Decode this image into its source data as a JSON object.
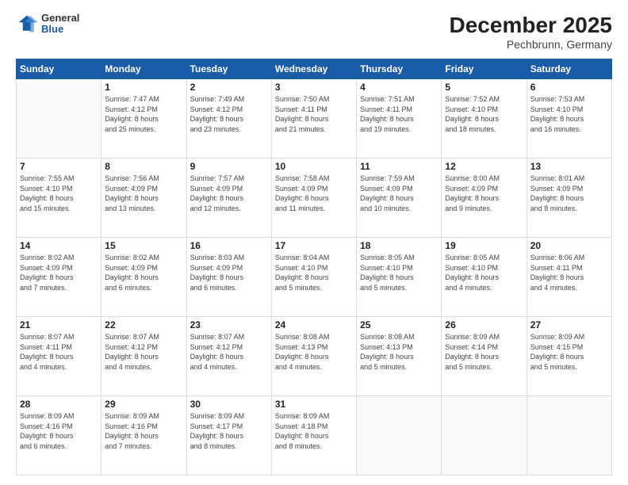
{
  "header": {
    "logo_general": "General",
    "logo_blue": "Blue",
    "title": "December 2025",
    "subtitle": "Pechbrunn, Germany"
  },
  "days_of_week": [
    "Sunday",
    "Monday",
    "Tuesday",
    "Wednesday",
    "Thursday",
    "Friday",
    "Saturday"
  ],
  "weeks": [
    [
      {
        "num": "",
        "info": ""
      },
      {
        "num": "1",
        "info": "Sunrise: 7:47 AM\nSunset: 4:12 PM\nDaylight: 8 hours\nand 25 minutes."
      },
      {
        "num": "2",
        "info": "Sunrise: 7:49 AM\nSunset: 4:12 PM\nDaylight: 8 hours\nand 23 minutes."
      },
      {
        "num": "3",
        "info": "Sunrise: 7:50 AM\nSunset: 4:11 PM\nDaylight: 8 hours\nand 21 minutes."
      },
      {
        "num": "4",
        "info": "Sunrise: 7:51 AM\nSunset: 4:11 PM\nDaylight: 8 hours\nand 19 minutes."
      },
      {
        "num": "5",
        "info": "Sunrise: 7:52 AM\nSunset: 4:10 PM\nDaylight: 8 hours\nand 18 minutes."
      },
      {
        "num": "6",
        "info": "Sunrise: 7:53 AM\nSunset: 4:10 PM\nDaylight: 8 hours\nand 16 minutes."
      }
    ],
    [
      {
        "num": "7",
        "info": "Sunrise: 7:55 AM\nSunset: 4:10 PM\nDaylight: 8 hours\nand 15 minutes."
      },
      {
        "num": "8",
        "info": "Sunrise: 7:56 AM\nSunset: 4:09 PM\nDaylight: 8 hours\nand 13 minutes."
      },
      {
        "num": "9",
        "info": "Sunrise: 7:57 AM\nSunset: 4:09 PM\nDaylight: 8 hours\nand 12 minutes."
      },
      {
        "num": "10",
        "info": "Sunrise: 7:58 AM\nSunset: 4:09 PM\nDaylight: 8 hours\nand 11 minutes."
      },
      {
        "num": "11",
        "info": "Sunrise: 7:59 AM\nSunset: 4:09 PM\nDaylight: 8 hours\nand 10 minutes."
      },
      {
        "num": "12",
        "info": "Sunrise: 8:00 AM\nSunset: 4:09 PM\nDaylight: 8 hours\nand 9 minutes."
      },
      {
        "num": "13",
        "info": "Sunrise: 8:01 AM\nSunset: 4:09 PM\nDaylight: 8 hours\nand 8 minutes."
      }
    ],
    [
      {
        "num": "14",
        "info": "Sunrise: 8:02 AM\nSunset: 4:09 PM\nDaylight: 8 hours\nand 7 minutes."
      },
      {
        "num": "15",
        "info": "Sunrise: 8:02 AM\nSunset: 4:09 PM\nDaylight: 8 hours\nand 6 minutes."
      },
      {
        "num": "16",
        "info": "Sunrise: 8:03 AM\nSunset: 4:09 PM\nDaylight: 8 hours\nand 6 minutes."
      },
      {
        "num": "17",
        "info": "Sunrise: 8:04 AM\nSunset: 4:10 PM\nDaylight: 8 hours\nand 5 minutes."
      },
      {
        "num": "18",
        "info": "Sunrise: 8:05 AM\nSunset: 4:10 PM\nDaylight: 8 hours\nand 5 minutes."
      },
      {
        "num": "19",
        "info": "Sunrise: 8:05 AM\nSunset: 4:10 PM\nDaylight: 8 hours\nand 4 minutes."
      },
      {
        "num": "20",
        "info": "Sunrise: 8:06 AM\nSunset: 4:11 PM\nDaylight: 8 hours\nand 4 minutes."
      }
    ],
    [
      {
        "num": "21",
        "info": "Sunrise: 8:07 AM\nSunset: 4:11 PM\nDaylight: 8 hours\nand 4 minutes."
      },
      {
        "num": "22",
        "info": "Sunrise: 8:07 AM\nSunset: 4:12 PM\nDaylight: 8 hours\nand 4 minutes."
      },
      {
        "num": "23",
        "info": "Sunrise: 8:07 AM\nSunset: 4:12 PM\nDaylight: 8 hours\nand 4 minutes."
      },
      {
        "num": "24",
        "info": "Sunrise: 8:08 AM\nSunset: 4:13 PM\nDaylight: 8 hours\nand 4 minutes."
      },
      {
        "num": "25",
        "info": "Sunrise: 8:08 AM\nSunset: 4:13 PM\nDaylight: 8 hours\nand 5 minutes."
      },
      {
        "num": "26",
        "info": "Sunrise: 8:09 AM\nSunset: 4:14 PM\nDaylight: 8 hours\nand 5 minutes."
      },
      {
        "num": "27",
        "info": "Sunrise: 8:09 AM\nSunset: 4:15 PM\nDaylight: 8 hours\nand 5 minutes."
      }
    ],
    [
      {
        "num": "28",
        "info": "Sunrise: 8:09 AM\nSunset: 4:16 PM\nDaylight: 8 hours\nand 6 minutes."
      },
      {
        "num": "29",
        "info": "Sunrise: 8:09 AM\nSunset: 4:16 PM\nDaylight: 8 hours\nand 7 minutes."
      },
      {
        "num": "30",
        "info": "Sunrise: 8:09 AM\nSunset: 4:17 PM\nDaylight: 8 hours\nand 8 minutes."
      },
      {
        "num": "31",
        "info": "Sunrise: 8:09 AM\nSunset: 4:18 PM\nDaylight: 8 hours\nand 8 minutes."
      },
      {
        "num": "",
        "info": ""
      },
      {
        "num": "",
        "info": ""
      },
      {
        "num": "",
        "info": ""
      }
    ]
  ]
}
